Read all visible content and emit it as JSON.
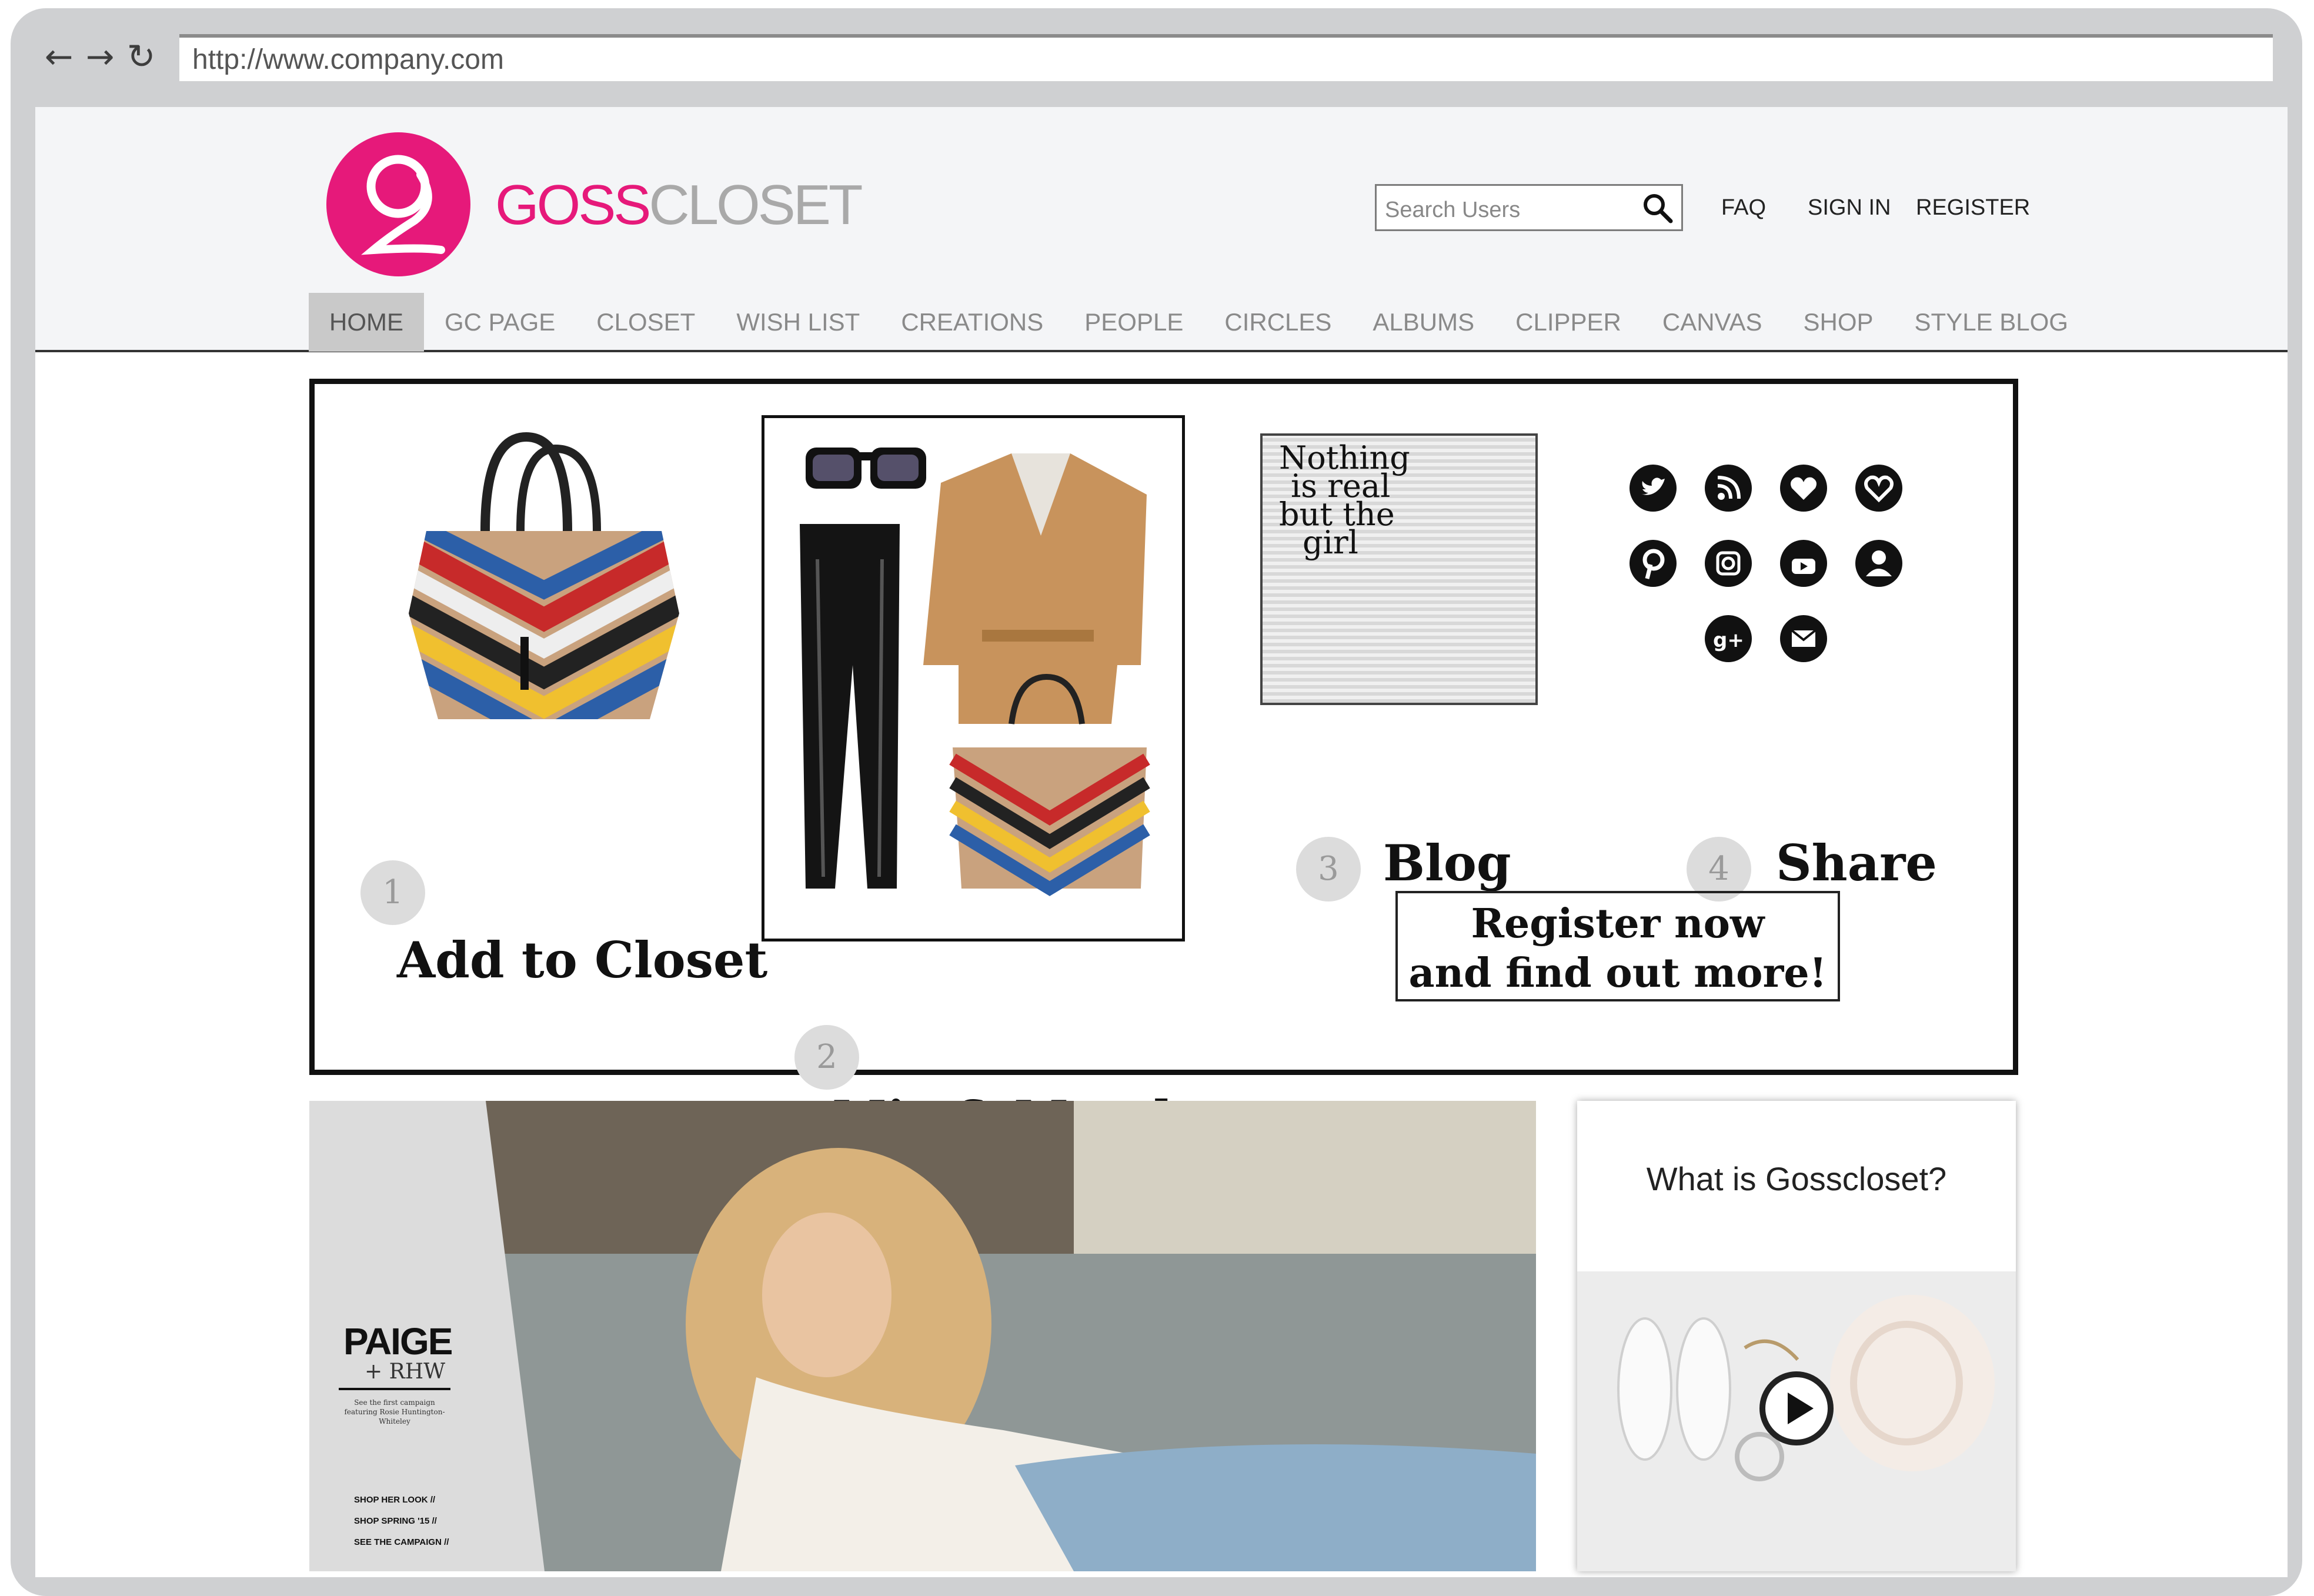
{
  "browser": {
    "url": "http://www.company.com",
    "buttons": {
      "back": "back-arrow-icon",
      "forward": "forward-arrow-icon",
      "reload": "reload-icon"
    }
  },
  "brand": {
    "logo_letter": "g",
    "name_part1": "GOSS",
    "name_part2": "CLOSET",
    "accent_color": "#e6197a"
  },
  "search": {
    "placeholder": "Search Users"
  },
  "top_links": {
    "faq": "FAQ",
    "sign_in": "SIGN IN",
    "register": "REGISTER"
  },
  "menu": [
    {
      "label": "HOME",
      "active": true
    },
    {
      "label": "GC PAGE"
    },
    {
      "label": "CLOSET"
    },
    {
      "label": "WISH LIST"
    },
    {
      "label": "CREATIONS"
    },
    {
      "label": "PEOPLE"
    },
    {
      "label": "CIRCLES"
    },
    {
      "label": "ALBUMS"
    },
    {
      "label": "CLIPPER"
    },
    {
      "label": "CANVAS"
    },
    {
      "label": "SHOP"
    },
    {
      "label": "STYLE BLOG"
    }
  ],
  "hero": {
    "steps": [
      {
        "num": "1",
        "label": "Add to Closet"
      },
      {
        "num": "2",
        "label": "Mix & Match"
      },
      {
        "num": "3",
        "label": "Blog"
      },
      {
        "num": "4",
        "label": "Share"
      }
    ],
    "blog_thumb_text": [
      "Nothing",
      "is real",
      "but the",
      "girl"
    ],
    "social_icons": [
      "twitter-icon",
      "rss-icon",
      "bloglovin-icon",
      "heart-icon",
      "pinterest-icon",
      "instagram-icon",
      "youtube-icon",
      "profile-icon",
      "google-plus-icon",
      "email-icon"
    ],
    "register_cta": [
      "Register now",
      "and find out more!"
    ]
  },
  "feature": {
    "title": "PAIGE",
    "subtitle": "+ RHW",
    "blurb": "See the first campaign featuring Rosie Huntington-Whiteley",
    "links": [
      "SHOP HER LOOK //",
      "SHOP SPRING '15 //",
      "SEE THE CAMPAIGN //"
    ]
  },
  "side": {
    "title": "What is Gosscloset?",
    "play_icon": "play-icon"
  }
}
